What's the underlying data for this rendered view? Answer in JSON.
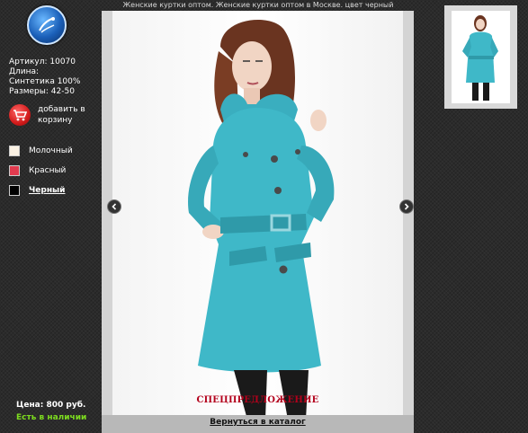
{
  "header": {
    "title": "Женские куртки оптом. Женские куртки оптом в Москве. цвет черный"
  },
  "product": {
    "article": "Артикул: 10070",
    "length": "Длина:",
    "material": "Синтетика 100%",
    "sizes": "Размеры: 42-50",
    "cart_label": "добавить в корзину",
    "price_label": "Цена:",
    "price_value": "800 руб.",
    "stock": "Есть в наличии"
  },
  "colors": [
    {
      "label": "Молочный",
      "swatch": "#faf1e3",
      "active": false
    },
    {
      "label": "Красный",
      "swatch": "#e23b4f",
      "active": false
    },
    {
      "label": "Черный",
      "swatch": "#000000",
      "active": true
    }
  ],
  "gallery": {
    "special_offer": "СПЕЦПРЕДЛОЖЕНИЕ",
    "back_link": "Вернуться в каталог",
    "prev_icon": "chevron-left-icon",
    "next_icon": "chevron-right-icon",
    "jacket_color": "#3fb8c8"
  },
  "theme": {
    "background": "#2b2b2b",
    "stock_color": "#7ddc1f",
    "special_color": "#b3001b"
  }
}
